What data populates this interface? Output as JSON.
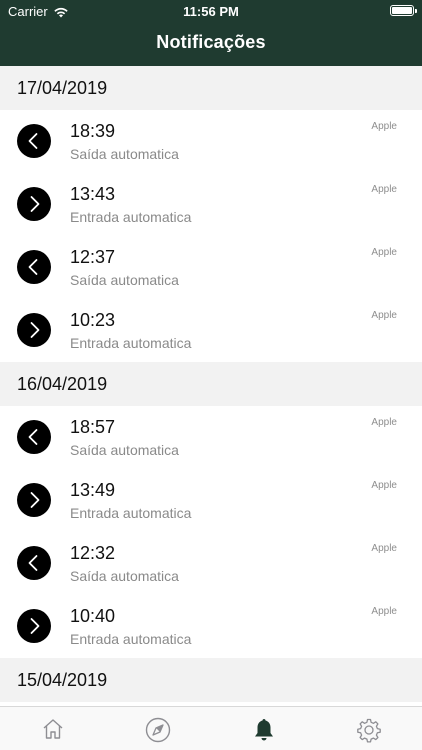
{
  "status": {
    "carrier": "Carrier",
    "time": "11:56 PM"
  },
  "header": {
    "title": "Notificações"
  },
  "sections": [
    {
      "date": "17/04/2019",
      "items": [
        {
          "time": "18:39",
          "desc": "Saída automatica",
          "source": "Apple",
          "direction": "out"
        },
        {
          "time": "13:43",
          "desc": "Entrada automatica",
          "source": "Apple",
          "direction": "in"
        },
        {
          "time": "12:37",
          "desc": "Saída automatica",
          "source": "Apple",
          "direction": "out"
        },
        {
          "time": "10:23",
          "desc": "Entrada automatica",
          "source": "Apple",
          "direction": "in"
        }
      ]
    },
    {
      "date": "16/04/2019",
      "items": [
        {
          "time": "18:57",
          "desc": "Saída automatica",
          "source": "Apple",
          "direction": "out"
        },
        {
          "time": "13:49",
          "desc": "Entrada automatica",
          "source": "Apple",
          "direction": "in"
        },
        {
          "time": "12:32",
          "desc": "Saída automatica",
          "source": "Apple",
          "direction": "out"
        },
        {
          "time": "10:40",
          "desc": "Entrada automatica",
          "source": "Apple",
          "direction": "in"
        }
      ]
    },
    {
      "date": "15/04/2019",
      "items": []
    }
  ],
  "tabbar": {
    "tabs": [
      {
        "icon": "home-icon",
        "active": false
      },
      {
        "icon": "navigation-icon",
        "active": false
      },
      {
        "icon": "bell-icon",
        "active": true
      },
      {
        "icon": "gear-icon",
        "active": false
      }
    ],
    "active_color": "#1f3b30",
    "inactive_color": "#8e8e93"
  },
  "colors": {
    "header_bg": "#1f3b30",
    "section_bg": "#f2f2f2"
  }
}
